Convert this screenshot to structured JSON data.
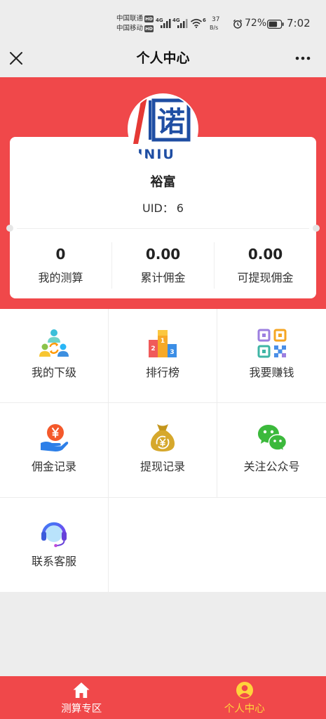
{
  "status_bar": {
    "carrier_1": "中国联通",
    "carrier_2": "中国移动",
    "hd_1": "HD",
    "hd_2": "HD",
    "network_1": "4G",
    "network_2": "4G",
    "wifi_badge": "6",
    "speed_value": "37",
    "speed_unit": "B/s",
    "battery_percent": "72%",
    "battery_level": 0.72,
    "time": "7:02",
    "icons": [
      "signal-icon",
      "wifi-icon",
      "alarm-icon",
      "battery-icon"
    ]
  },
  "nav": {
    "title": "个人中心",
    "left_icon": "close-icon",
    "right_icon": "more-icon"
  },
  "profile": {
    "avatar_logo": {
      "glyph": "诺",
      "text": "UNIU"
    },
    "name": "裕富",
    "uid_label": "UID：",
    "uid_value": "6"
  },
  "stats": [
    {
      "value": "0",
      "label": "我的测算"
    },
    {
      "value": "0.00",
      "label": "累计佣金"
    },
    {
      "value": "0.00",
      "label": "可提现佣金"
    }
  ],
  "menu": [
    {
      "label": "我的下级",
      "icon": "team-icon"
    },
    {
      "label": "排行榜",
      "icon": "ranking-podium-icon",
      "ranks": [
        "1",
        "2",
        "3"
      ]
    },
    {
      "label": "我要赚钱",
      "icon": "qr-code-icon"
    },
    {
      "label": "佣金记录",
      "icon": "commission-coin-hand-icon"
    },
    {
      "label": "提现记录",
      "icon": "money-bag-icon"
    },
    {
      "label": "关注公众号",
      "icon": "wechat-icon"
    },
    {
      "label": "联系客服",
      "icon": "customer-service-headset-icon"
    }
  ],
  "tabbar": [
    {
      "label": "测算专区",
      "icon": "home-icon",
      "active": false
    },
    {
      "label": "个人中心",
      "icon": "user-icon",
      "active": true
    }
  ],
  "colors": {
    "primary": "#f0484a",
    "active_tab": "#ffd43b",
    "page_background": "#ededed",
    "text": "#333333"
  }
}
